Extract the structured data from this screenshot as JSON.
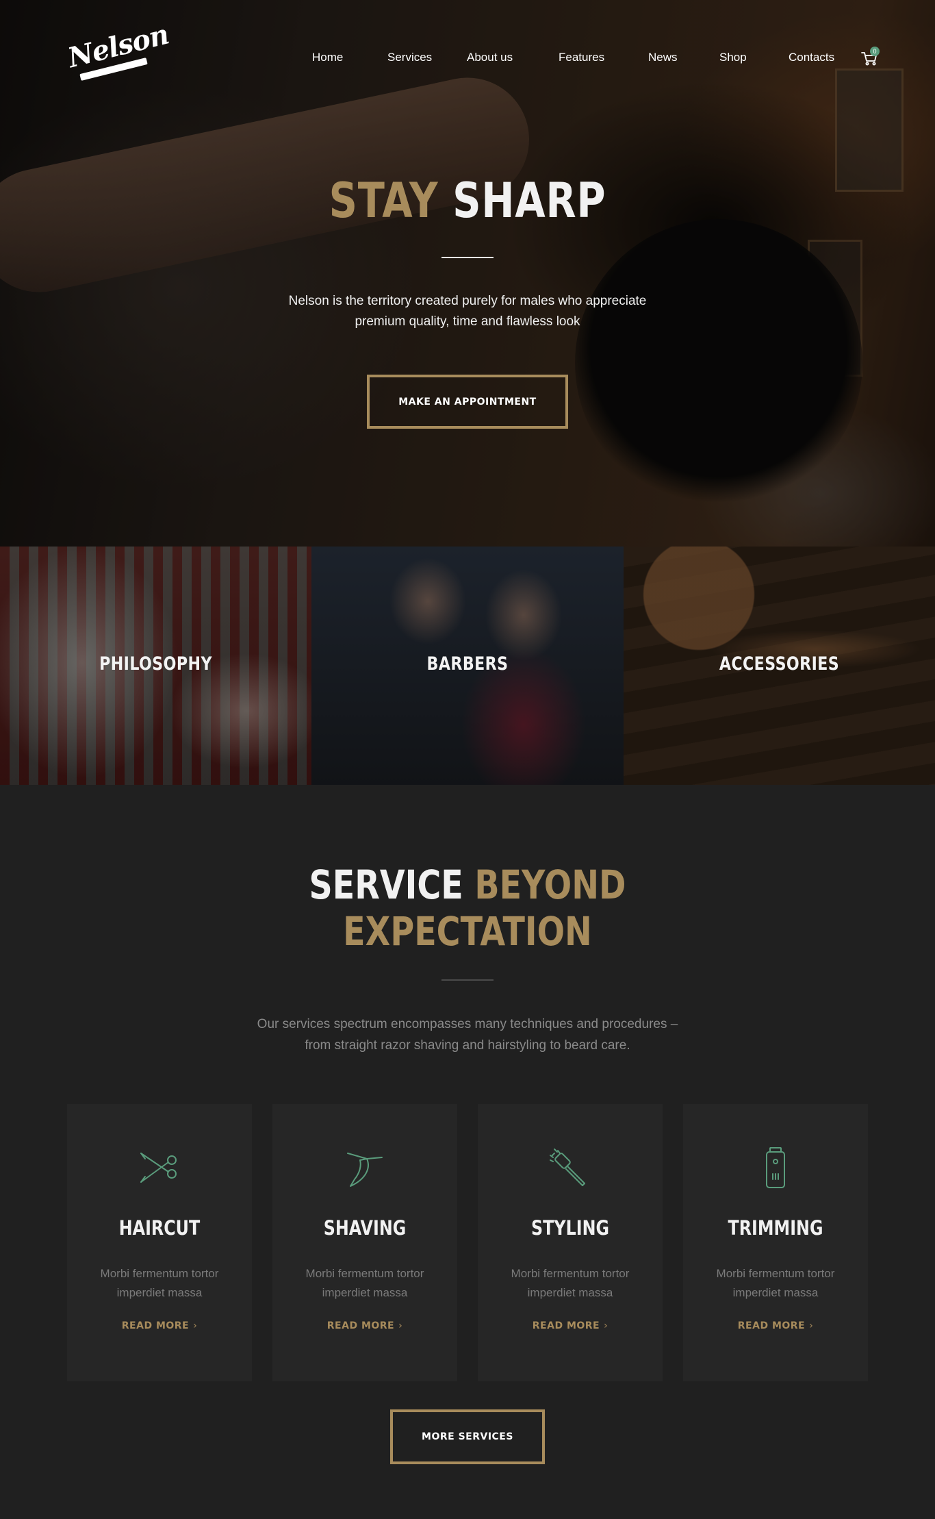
{
  "brand": {
    "logo_text": "Nelson"
  },
  "nav": {
    "items": [
      "Home",
      "Services",
      "About us",
      "Features",
      "News",
      "Shop",
      "Contacts"
    ],
    "cart_count": "0"
  },
  "hero": {
    "title_part1": "STAY",
    "title_part2": "SHARP",
    "description_line1": "Nelson is the territory created purely for males who appreciate",
    "description_line2": "premium quality, time and flawless look",
    "cta_label": "MAKE AN APPOINTMENT"
  },
  "tiles": [
    "PHILOSOPHY",
    "BARBERS",
    "ACCESSORIES"
  ],
  "services": {
    "title_word1": "SERVICE",
    "title_word2": "BEYOND",
    "title_line2": "EXPECTATION",
    "description_line1": "Our services spectrum encompasses many techniques and procedures –",
    "description_line2": "from straight razor shaving and hairstyling to beard care.",
    "cards": [
      {
        "title": "HAIRCUT",
        "desc_line1": "Morbi fermentum tortor",
        "desc_line2": "imperdiet massa",
        "link": "READ MORE",
        "icon": "scissors-icon"
      },
      {
        "title": "SHAVING",
        "desc_line1": "Morbi fermentum tortor",
        "desc_line2": "imperdiet massa",
        "link": "READ MORE",
        "icon": "razor-icon"
      },
      {
        "title": "STYLING",
        "desc_line1": "Morbi fermentum tortor",
        "desc_line2": "imperdiet massa",
        "link": "READ MORE",
        "icon": "comb-icon"
      },
      {
        "title": "TRIMMING",
        "desc_line1": "Morbi fermentum tortor",
        "desc_line2": "imperdiet massa",
        "link": "READ MORE",
        "icon": "trimmer-icon"
      }
    ],
    "more_label": "MORE SERVICES"
  },
  "colors": {
    "accent_gold": "#a88c5c",
    "icon_green": "#5a9c7c",
    "background": "#202020",
    "card": "#262626"
  }
}
